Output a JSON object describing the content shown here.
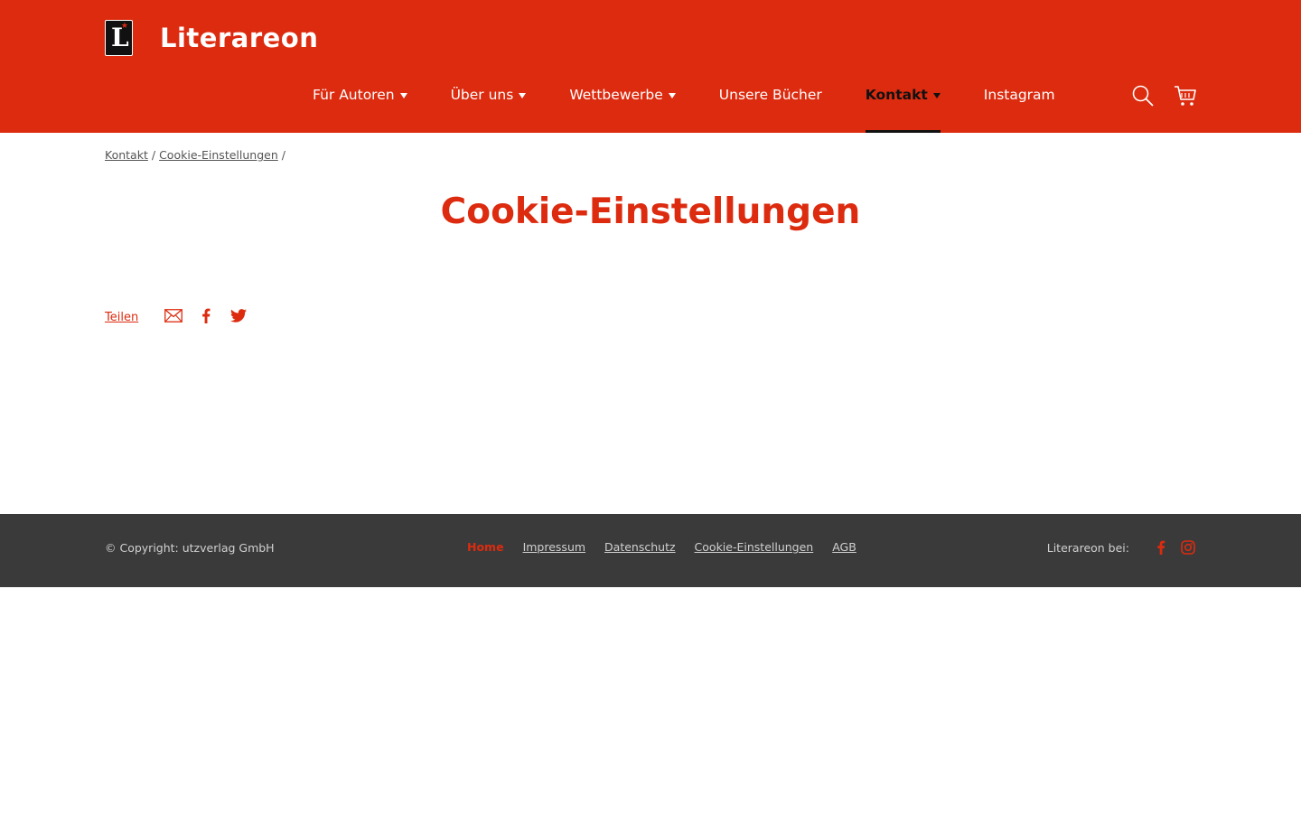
{
  "brand": {
    "name": "Literareon",
    "logo_letter": "L",
    "logo_star": "★"
  },
  "nav": {
    "items": [
      {
        "label": "Für Autoren",
        "has_caret": true
      },
      {
        "label": "Über uns",
        "has_caret": true
      },
      {
        "label": "Wettbewerbe",
        "has_caret": true
      },
      {
        "label": "Unsere Bücher",
        "has_caret": false
      },
      {
        "label": "Kontakt",
        "has_caret": true,
        "active": true
      },
      {
        "label": "Instagram",
        "has_caret": false
      }
    ],
    "icons": [
      "search-icon",
      "cart-icon"
    ]
  },
  "breadcrumb": {
    "items": [
      "Kontakt",
      "Cookie-Einstellungen"
    ],
    "separator": "/"
  },
  "page": {
    "title": "Cookie-Einstellungen"
  },
  "share": {
    "label": "Teilen",
    "icons": [
      "email-icon",
      "facebook-icon",
      "twitter-icon"
    ]
  },
  "footer": {
    "copyright": "© Copyright: utzverlag GmbH",
    "links": [
      "Home",
      "Impressum",
      "Datenschutz",
      "Cookie-Einstellungen",
      "AGB"
    ],
    "social_label": "Literareon bei:",
    "social_icons": [
      "facebook-icon",
      "instagram-icon"
    ]
  },
  "colors": {
    "brand_red": "#dc2b0f",
    "footer_bg": "#3a3a3a",
    "active_nav": "#111111"
  }
}
